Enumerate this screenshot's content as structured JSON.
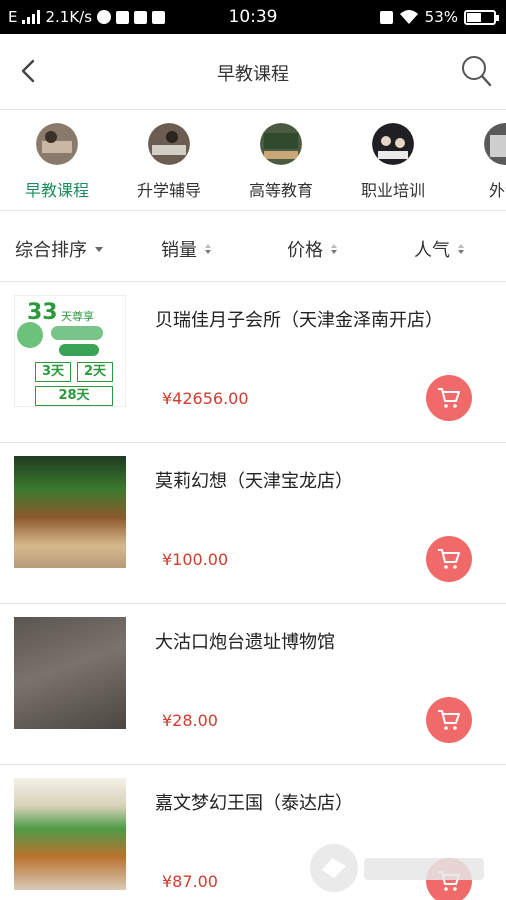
{
  "status_bar": {
    "carrier": "E",
    "speed": "2.1K/s",
    "time": "10:39",
    "battery": "53%",
    "battery_level": 0.53
  },
  "header": {
    "title": "早教课程"
  },
  "categories": [
    {
      "label": "早教课程",
      "active": true
    },
    {
      "label": "升学辅导",
      "active": false
    },
    {
      "label": "高等教育",
      "active": false
    },
    {
      "label": "职业培训",
      "active": false
    },
    {
      "label": "外语",
      "active": false
    }
  ],
  "sort": [
    {
      "label": "综合排序"
    },
    {
      "label": "销量"
    },
    {
      "label": "价格"
    },
    {
      "label": "人气"
    }
  ],
  "items": [
    {
      "name": "贝瑞佳月子会所（天津金泽南开店）",
      "price": "¥42656.00",
      "thumb_text": {
        "big": "33",
        "sub": "天尊享",
        "box1": "3天",
        "box2": "2天",
        "box3": "28天"
      }
    },
    {
      "name": "莫莉幻想（天津宝龙店）",
      "price": "¥100.00"
    },
    {
      "name": "大沽口炮台遗址博物馆",
      "price": "¥28.00"
    },
    {
      "name": "嘉文梦幻王国（泰达店）",
      "price": "¥87.00"
    }
  ],
  "colors": {
    "accent_green": "#1f8a5b",
    "price_red": "#d23b2e",
    "cart_button": "#f06a6a"
  },
  "icons": {
    "back": "chevron-left-icon",
    "search": "search-icon",
    "cart": "cart-icon"
  }
}
